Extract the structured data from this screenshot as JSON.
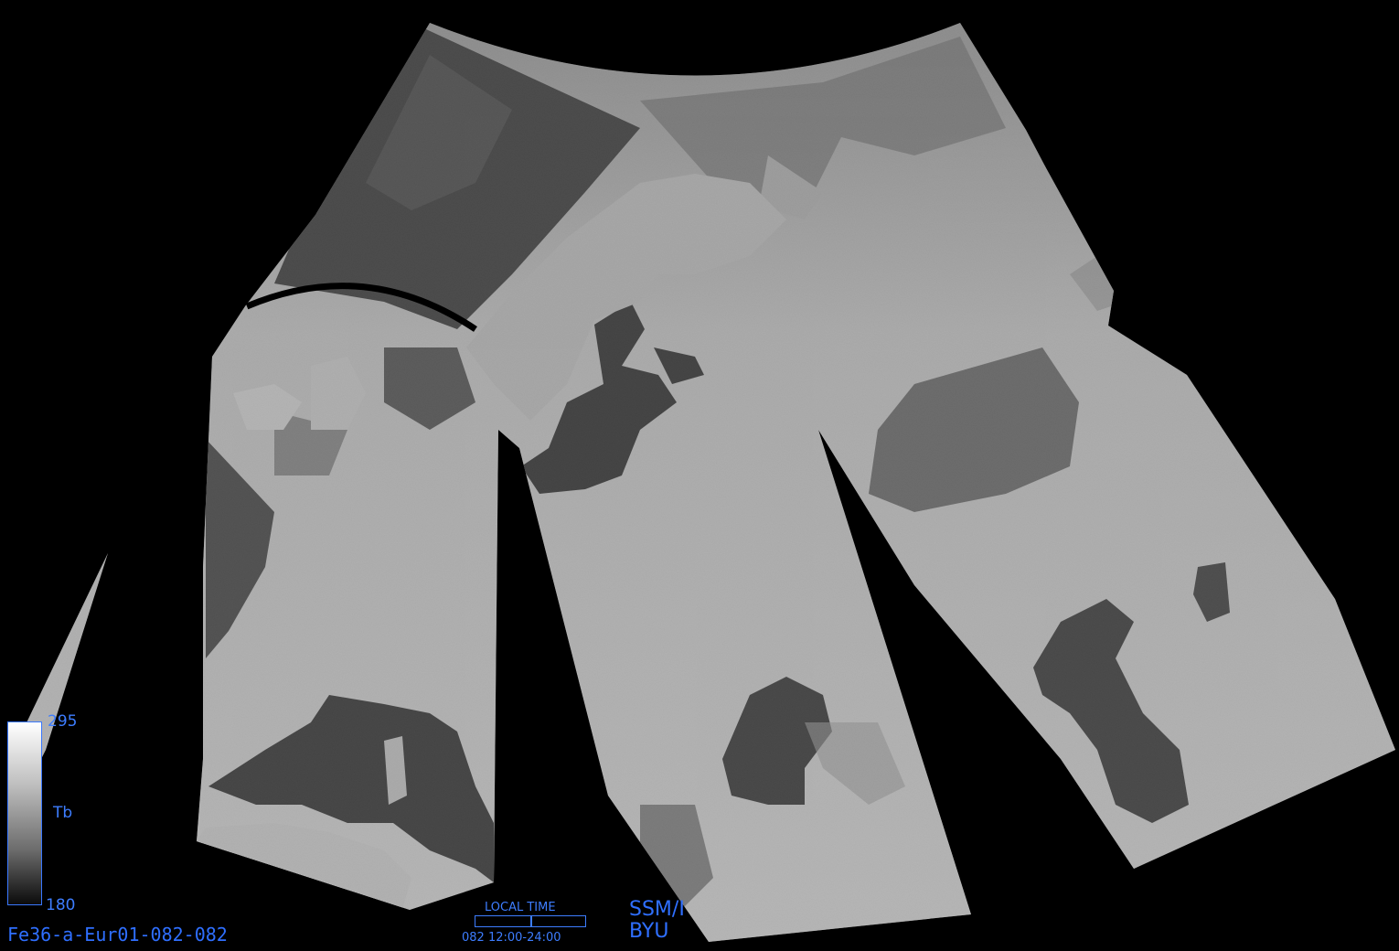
{
  "colorbar": {
    "max": "295",
    "label": "Tb",
    "min": "180"
  },
  "product_id": "Fe36-a-Eur01-082-082",
  "local_time": {
    "label": "LOCAL TIME",
    "range": "082 12:00-24:00",
    "fraction_shown": 0.5
  },
  "sensor": {
    "line1": "SSM/I",
    "line2": "BYU"
  },
  "colors": {
    "accent": "#2f6fff",
    "background": "#000000"
  }
}
